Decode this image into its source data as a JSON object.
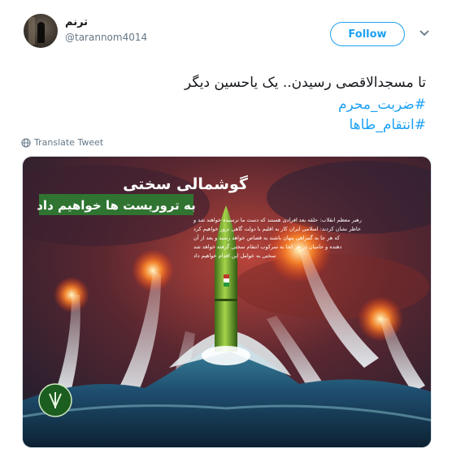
{
  "author": {
    "display_name": "ترنم",
    "handle": "@tarannom4014"
  },
  "follow_label": "Follow",
  "tweet": {
    "text": "تا مسجدالاقصی رسیدن.. یک یاحسین دیگر",
    "hashtag1": "#ضربت_محرم",
    "hashtag2": "#انتقام_طاها"
  },
  "translate_label": "Translate Tweet",
  "media": {
    "headline1": "گوشمالی سختی",
    "headline2": "به تروریست ها خواهیم داد",
    "body_lines": [
      "رهبر معظم انقلاب: حلقه بعد افرادی هستند که دست ما نرسیده خواهند شد و",
      "خاطر نشان کردند: اسلامی ایران کار به اقلیم با دولت گاهی ترور خواهیم کرد",
      "که هر جا به گمراهی پنهان باشند به قصاص خواهد رسید و بعد از آن",
      "دهنده و حامیان در هر کجا به سرکوب انتقام سختی گرفته خواهد شد",
      "سختی به عوامل این اقدام خواهیم داد"
    ]
  },
  "colors": {
    "accent": "#1da1f2",
    "text": "#14171a",
    "secondary": "#657786"
  }
}
